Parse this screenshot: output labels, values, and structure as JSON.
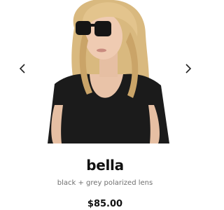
{
  "product": {
    "name": "bella",
    "description": "black + grey polarized lens",
    "price": "$85.00"
  },
  "carousel": {
    "prev_icon": "chevron-left-icon",
    "next_icon": "chevron-right-icon"
  },
  "colors": {
    "text": "#111111",
    "muted": "#6f6f6f",
    "background": "#ffffff"
  }
}
